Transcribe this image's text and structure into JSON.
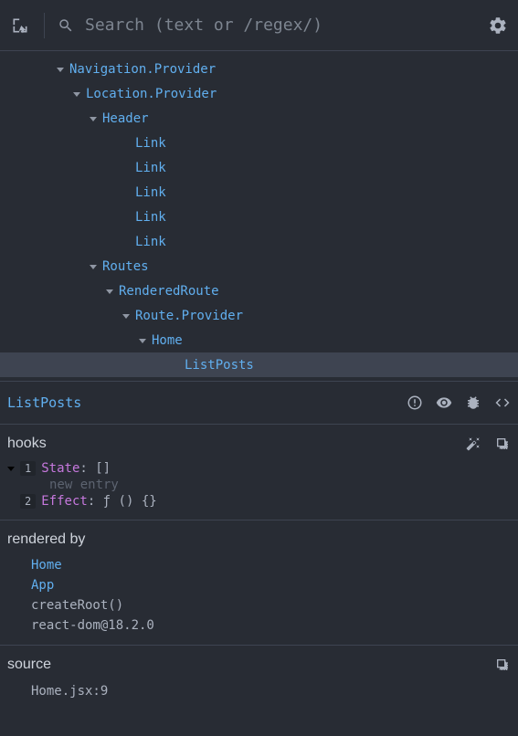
{
  "search": {
    "placeholder": "Search (text or /regex/)"
  },
  "tree": [
    {
      "label": "Navigation.Provider",
      "indent": 60,
      "expanded": true
    },
    {
      "label": "Location.Provider",
      "indent": 78,
      "expanded": true
    },
    {
      "label": "Header",
      "indent": 96,
      "expanded": true
    },
    {
      "label": "Link",
      "indent": 132,
      "expanded": false,
      "leaf": true
    },
    {
      "label": "Link",
      "indent": 132,
      "expanded": false,
      "leaf": true
    },
    {
      "label": "Link",
      "indent": 132,
      "expanded": false,
      "leaf": true
    },
    {
      "label": "Link",
      "indent": 132,
      "expanded": false,
      "leaf": true
    },
    {
      "label": "Link",
      "indent": 132,
      "expanded": false,
      "leaf": true
    },
    {
      "label": "Routes",
      "indent": 96,
      "expanded": true
    },
    {
      "label": "RenderedRoute",
      "indent": 114,
      "expanded": true
    },
    {
      "label": "Route.Provider",
      "indent": 132,
      "expanded": true
    },
    {
      "label": "Home",
      "indent": 150,
      "expanded": true
    },
    {
      "label": "ListPosts",
      "indent": 186,
      "expanded": false,
      "leaf": true,
      "selected": true
    }
  ],
  "selected": {
    "name": "ListPosts"
  },
  "hooks": {
    "title": "hooks",
    "items": [
      {
        "num": "1",
        "label": "State",
        "value": "[]",
        "expandable": true,
        "new_entry": "new entry"
      },
      {
        "num": "2",
        "label": "Effect",
        "value": "ƒ () {}",
        "expandable": false
      }
    ]
  },
  "rendered_by": {
    "title": "rendered by",
    "items": [
      {
        "label": "Home",
        "link": true
      },
      {
        "label": "App",
        "link": true
      },
      {
        "label": "createRoot()",
        "link": false
      },
      {
        "label": "react-dom@18.2.0",
        "link": false
      }
    ]
  },
  "source": {
    "title": "source",
    "location": "Home.jsx:9"
  }
}
